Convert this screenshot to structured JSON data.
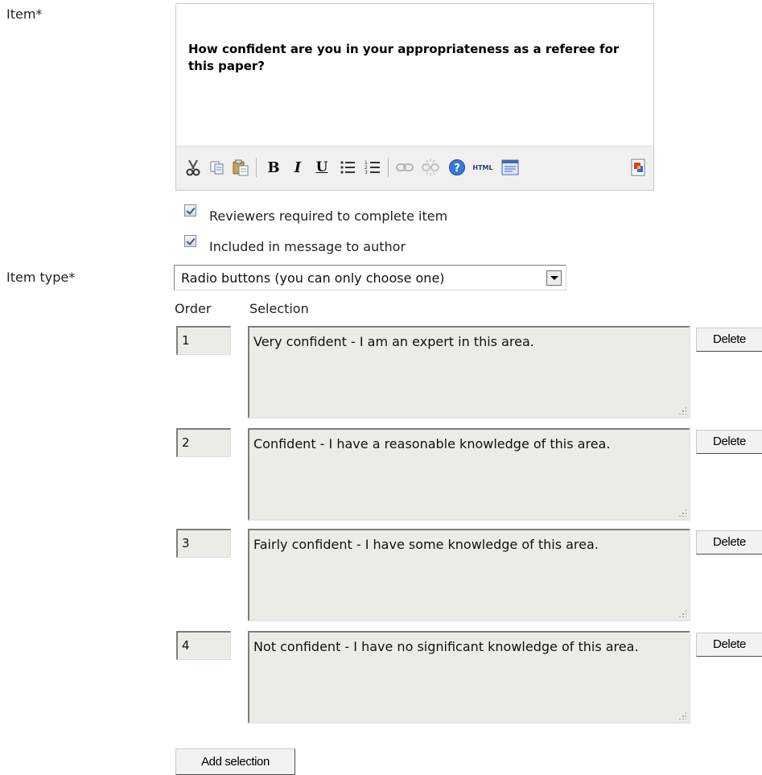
{
  "item": {
    "label": "Item*",
    "text": "How confident are you in your appropriateness as a referee for this paper?"
  },
  "toolbar": {
    "buttons": [
      "cut-icon",
      "copy-icon",
      "paste-icon",
      "bold-icon",
      "italic-icon",
      "underline-icon",
      "bullet-list-icon",
      "numbered-list-icon",
      "link-icon",
      "unlink-icon",
      "help-icon",
      "html-icon",
      "code-icon",
      "paste-word-icon"
    ],
    "bold": "B",
    "italic": "I",
    "underline": "U",
    "html": "HTML"
  },
  "checkboxes": {
    "required": {
      "label": "Reviewers required to complete item",
      "checked": true
    },
    "included": {
      "label": "Included in message to author",
      "checked": true
    }
  },
  "item_type": {
    "label": "Item type*",
    "value": "Radio buttons (you can only choose one)"
  },
  "columns": {
    "order": "Order",
    "selection": "Selection"
  },
  "selections": [
    {
      "order": "1",
      "text": "Very confident - I am an expert in this area.",
      "delete": "Delete"
    },
    {
      "order": "2",
      "text": "Confident - I have a reasonable knowledge of this area.",
      "delete": "Delete"
    },
    {
      "order": "3",
      "text": "Fairly confident - I have some knowledge of this area.",
      "delete": "Delete"
    },
    {
      "order": "4",
      "text": "Not confident - I have no significant knowledge of this area.",
      "delete": "Delete"
    }
  ],
  "add_button": "Add selection",
  "colors": {
    "field_bg": "#ecebe6",
    "toolbar_bg": "#f0f0ee",
    "checkbox_mark": "#2a58b5"
  }
}
